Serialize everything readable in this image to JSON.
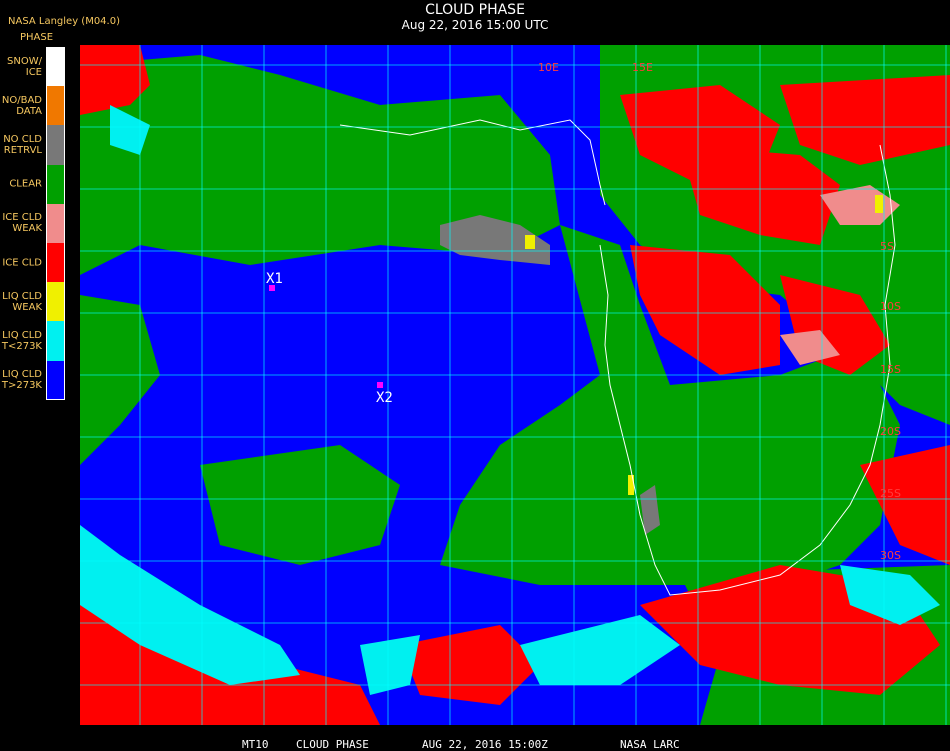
{
  "header": {
    "title": "CLOUD PHASE",
    "subtitle": "Aug 22, 2016 15:00 UTC",
    "producer": "NASA Langley (M04.0)"
  },
  "legend": {
    "title": "PHASE",
    "items": [
      {
        "label": "SNOW/\nICE",
        "color": "#ffffff"
      },
      {
        "label": "NO/BAD\nDATA",
        "color": "#f07800"
      },
      {
        "label": "NO CLD\nRETRVL",
        "color": "#787878"
      },
      {
        "label": "CLEAR",
        "color": "#00a000"
      },
      {
        "label": "ICE CLD\nWEAK",
        "color": "#f08c8c"
      },
      {
        "label": "ICE CLD",
        "color": "#ff0000"
      },
      {
        "label": "LIQ CLD\nWEAK",
        "color": "#f0f000"
      },
      {
        "label": "LIQ CLD\nT<273K",
        "color": "#00f0f0"
      },
      {
        "label": "LIQ CLD\nT>273K",
        "color": "#0000ff"
      }
    ]
  },
  "map": {
    "grid_color": "#00ffff",
    "coast_color": "#ffffff",
    "lat_labels": [
      "5S",
      "10S",
      "15S",
      "20S",
      "25S",
      "30S"
    ],
    "lon_labels": [
      "10E",
      "15E"
    ],
    "markers": [
      {
        "label": "X1",
        "color": "#ff00ff"
      },
      {
        "label": "X2",
        "color": "#ff00ff"
      }
    ]
  },
  "footer": {
    "id": "MT10",
    "product": "CLOUD PHASE",
    "datetime": "AUG 22, 2016 15:00Z",
    "source": "NASA LARC"
  }
}
